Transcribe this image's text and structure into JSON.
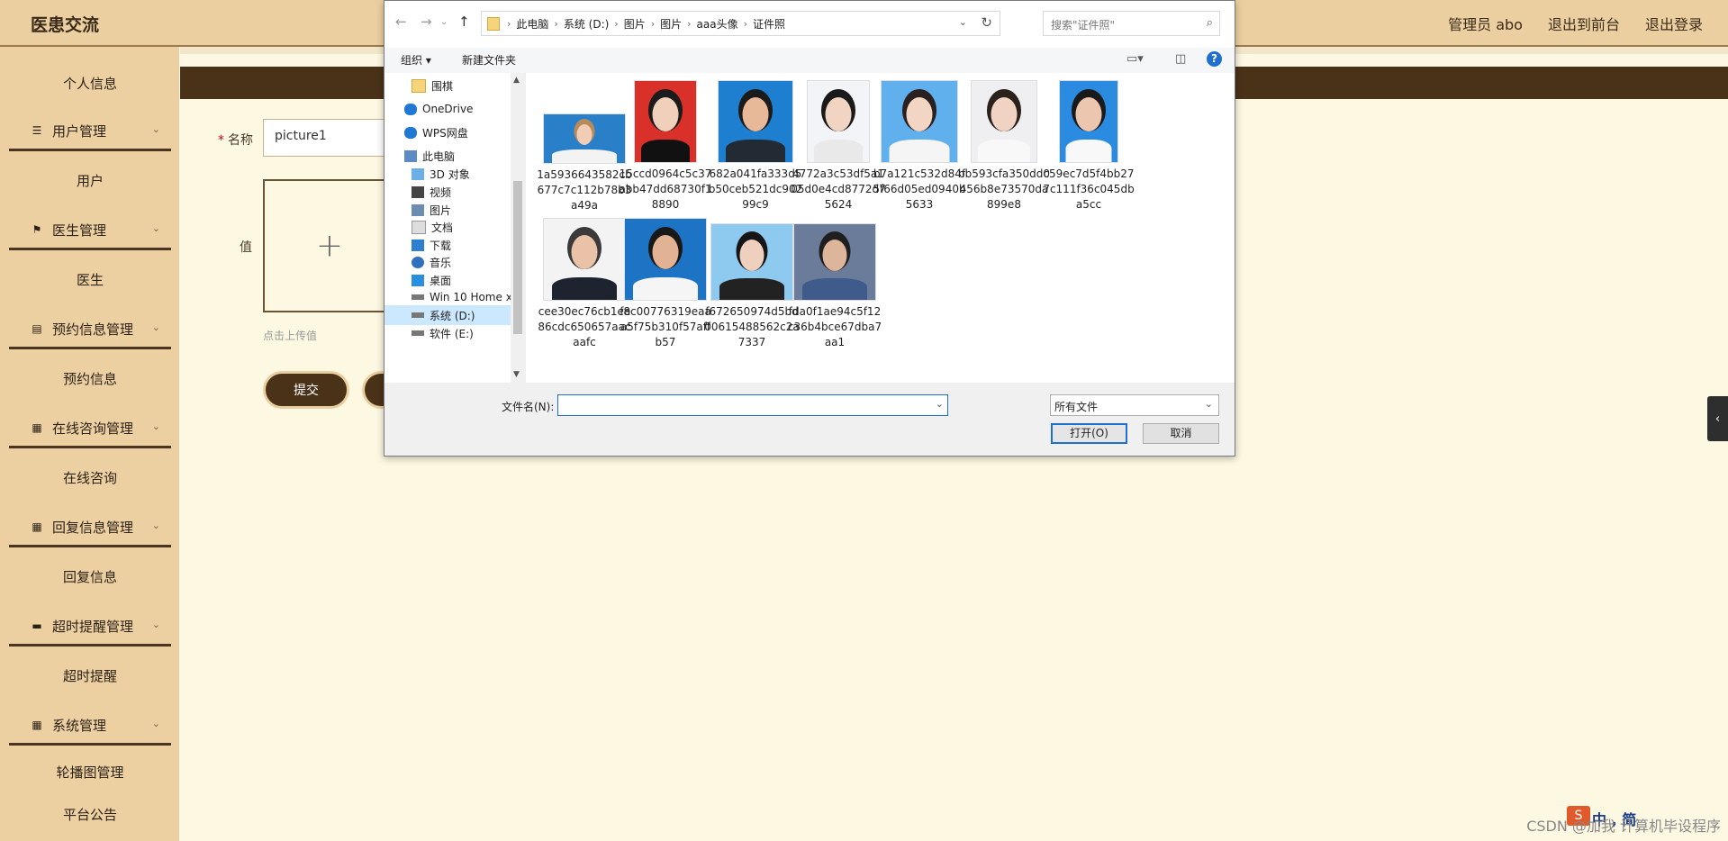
{
  "app": {
    "title": "医患交流"
  },
  "top_links": [
    "管理员 abo",
    "退出到前台",
    "退出登录"
  ],
  "sidebar": {
    "items": [
      {
        "label": "个人信息",
        "type": "child"
      },
      {
        "label": "用户管理",
        "type": "parent",
        "icon": "sliders-icon"
      },
      {
        "label": "用户",
        "type": "child"
      },
      {
        "label": "医生管理",
        "type": "parent",
        "icon": "flag-icon"
      },
      {
        "label": "医生",
        "type": "child"
      },
      {
        "label": "预约信息管理",
        "type": "parent",
        "icon": "clipboard-icon"
      },
      {
        "label": "预约信息",
        "type": "child"
      },
      {
        "label": "在线咨询管理",
        "type": "parent",
        "icon": "grid-icon"
      },
      {
        "label": "在线咨询",
        "type": "child"
      },
      {
        "label": "回复信息管理",
        "type": "parent",
        "icon": "grid-icon"
      },
      {
        "label": "回复信息",
        "type": "child"
      },
      {
        "label": "超时提醒管理",
        "type": "parent",
        "icon": "monitor-icon"
      },
      {
        "label": "超时提醒",
        "type": "child"
      },
      {
        "label": "系统管理",
        "type": "parent",
        "icon": "grid-icon"
      },
      {
        "label": "轮播图管理",
        "type": "child"
      },
      {
        "label": "平台公告",
        "type": "child"
      }
    ]
  },
  "form": {
    "name_label": "名称",
    "name_value": "picture1",
    "value_label": "值",
    "upload_hint": "点击上传值",
    "submit_label": "提交"
  },
  "dialog": {
    "breadcrumb": [
      "此电脑",
      "系统 (D:)",
      "图片",
      "图片",
      "aaa头像",
      "证件照"
    ],
    "search_placeholder": "搜索\"证件照\"",
    "toolbar": {
      "organize": "组织 ▾",
      "new_folder": "新建文件夹"
    },
    "tree": [
      {
        "label": "围棋",
        "icon": "folder-icon",
        "indent": 1
      },
      {
        "label": "OneDrive",
        "icon": "cloud-icon",
        "indent": 0
      },
      {
        "label": "WPS网盘",
        "icon": "cloud-icon",
        "indent": 0
      },
      {
        "label": "此电脑",
        "icon": "computer-icon",
        "indent": 0
      },
      {
        "label": "3D 对象",
        "icon": "cube-icon",
        "indent": 1
      },
      {
        "label": "视频",
        "icon": "video-icon",
        "indent": 1
      },
      {
        "label": "图片",
        "icon": "picture-icon",
        "indent": 1
      },
      {
        "label": "文档",
        "icon": "document-icon",
        "indent": 1
      },
      {
        "label": "下载",
        "icon": "download-icon",
        "indent": 1
      },
      {
        "label": "音乐",
        "icon": "music-icon",
        "indent": 1
      },
      {
        "label": "桌面",
        "icon": "desktop-icon",
        "indent": 1
      },
      {
        "label": "Win 10 Home x",
        "icon": "drive-icon",
        "indent": 1
      },
      {
        "label": "系统 (D:)",
        "icon": "drive-icon",
        "indent": 1,
        "selected": true
      },
      {
        "label": "软件 (E:)",
        "icon": "drive-icon",
        "indent": 1
      }
    ],
    "files": [
      {
        "name": "1a5936643582cb677c7c112b78b3a49a",
        "bg": "#2a7fc9",
        "skin": "#f1cdb5",
        "hair": "#b88b5a",
        "cloth": "#f3f3f3"
      },
      {
        "name": "15ccd0964c5c37abb47dd68730f18890",
        "bg": "#d9302a",
        "skin": "#f0cfbb",
        "hair": "#1b1b1b",
        "cloth": "#111111"
      },
      {
        "name": "682a041fa333d5b50ceb521dc90299c9",
        "bg": "#1e7fd0",
        "skin": "#e7b998",
        "hair": "#1b1b1b",
        "cloth": "#222a33"
      },
      {
        "name": "4772a3c53df5a105d0e4cd8772d75624",
        "bg": "#f2f4f7",
        "skin": "#f2d4c2",
        "hair": "#1a1a1a",
        "cloth": "#e9e9e9"
      },
      {
        "name": "b7a121c532d84f5f66d05ed0940b5633",
        "bg": "#5fb0ec",
        "skin": "#f3d5c3",
        "hair": "#2a2020",
        "cloth": "#f5f5f5"
      },
      {
        "name": "bb593cfa350dd0456b8e73570da899e8",
        "bg": "#efeff1",
        "skin": "#f1d3c4",
        "hair": "#2b221d",
        "cloth": "#f8f8f8"
      },
      {
        "name": "c59ec7d5f4bb277c111f36c045dba5cc",
        "bg": "#2a8be0",
        "skin": "#ecc6ae",
        "hair": "#1a1a1a",
        "cloth": "#f8f8f8"
      },
      {
        "name": "cee30ec76cb1ee86cdc650657aacaafc",
        "bg": "#f3f3f3",
        "skin": "#e9c2a8",
        "hair": "#3a3a3a",
        "cloth": "#1d2430"
      },
      {
        "name": "f8c00776319eaaa5f75b310f57affb57",
        "bg": "#1d73c4",
        "skin": "#e1b394",
        "hair": "#181818",
        "cloth": "#f5f5f5"
      },
      {
        "name": "f672650974d5bd00615488562c2a7337",
        "bg": "#8ec9f0",
        "skin": "#efcfbd",
        "hair": "#161616",
        "cloth": "#222222"
      },
      {
        "name": "fda0f1ae94c5f12c36b4bce67dba7aa1",
        "bg": "#6a7c9a",
        "skin": "#dcb59a",
        "hair": "#1f1f1f",
        "cloth": "#3e5b8c"
      }
    ],
    "filename_label": "文件名(N):",
    "filename_value": "",
    "filetype": "所有文件",
    "open_label": "打开(O)",
    "cancel_label": "取消"
  },
  "watermark": "CSDN @加我 计算机毕设程序",
  "ime": {
    "icon": "S",
    "text": "中 ,  简"
  }
}
